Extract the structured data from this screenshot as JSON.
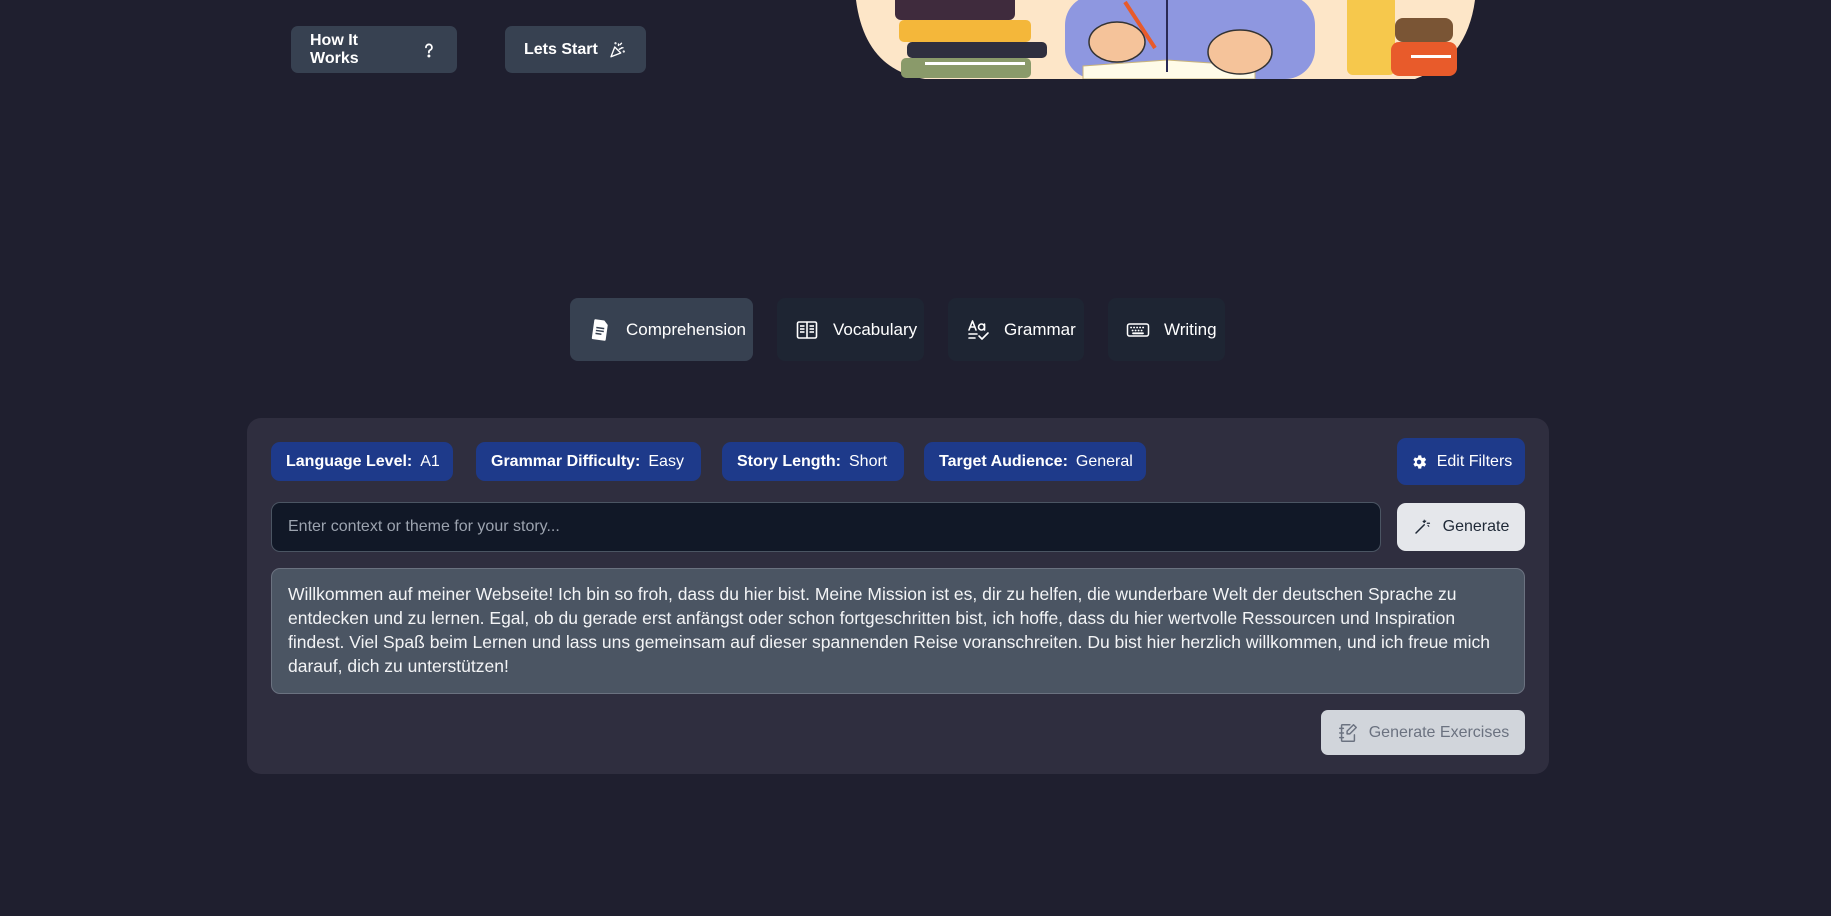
{
  "hero": {
    "how_label": "How It Works",
    "start_label": "Lets Start"
  },
  "tabs": [
    {
      "label": "Comprehension",
      "icon": "document-icon",
      "active": true
    },
    {
      "label": "Vocabulary",
      "icon": "book-open-icon",
      "active": false
    },
    {
      "label": "Grammar",
      "icon": "spellcheck-icon",
      "active": false
    },
    {
      "label": "Writing",
      "icon": "keyboard-icon",
      "active": false
    }
  ],
  "filters": {
    "level": {
      "key": "Language Level:",
      "value": "A1"
    },
    "grammar": {
      "key": "Grammar Difficulty:",
      "value": "Easy"
    },
    "length": {
      "key": "Story Length:",
      "value": "Short"
    },
    "audience": {
      "key": "Target Audience:",
      "value": "General"
    },
    "edit_label": "Edit Filters"
  },
  "context": {
    "placeholder": "Enter context or theme for your story...",
    "value": "",
    "generate_label": "Generate"
  },
  "story": {
    "text": "Willkommen auf meiner Webseite! Ich bin so froh, dass du hier bist. Meine Mission ist es, dir zu helfen, die wunderbare Welt der deutschen Sprache zu entdecken und zu lernen. Egal, ob du gerade erst anfängst oder schon fortgeschritten bist, ich hoffe, dass du hier wertvolle Ressourcen und Inspiration findest. Viel Spaß beim Lernen und lass uns gemeinsam auf dieser spannenden Reise voranschreiten. Du bist hier herzlich willkommen, und ich freue mich darauf, dich zu unterstützen!"
  },
  "exercises": {
    "label": "Generate Exercises",
    "disabled": true
  },
  "colors": {
    "background": "#1f1f2f",
    "panel": "#2f2e3f",
    "chip": "#1e3a8a",
    "tab": "#1e2533",
    "tab_active": "#374151"
  }
}
